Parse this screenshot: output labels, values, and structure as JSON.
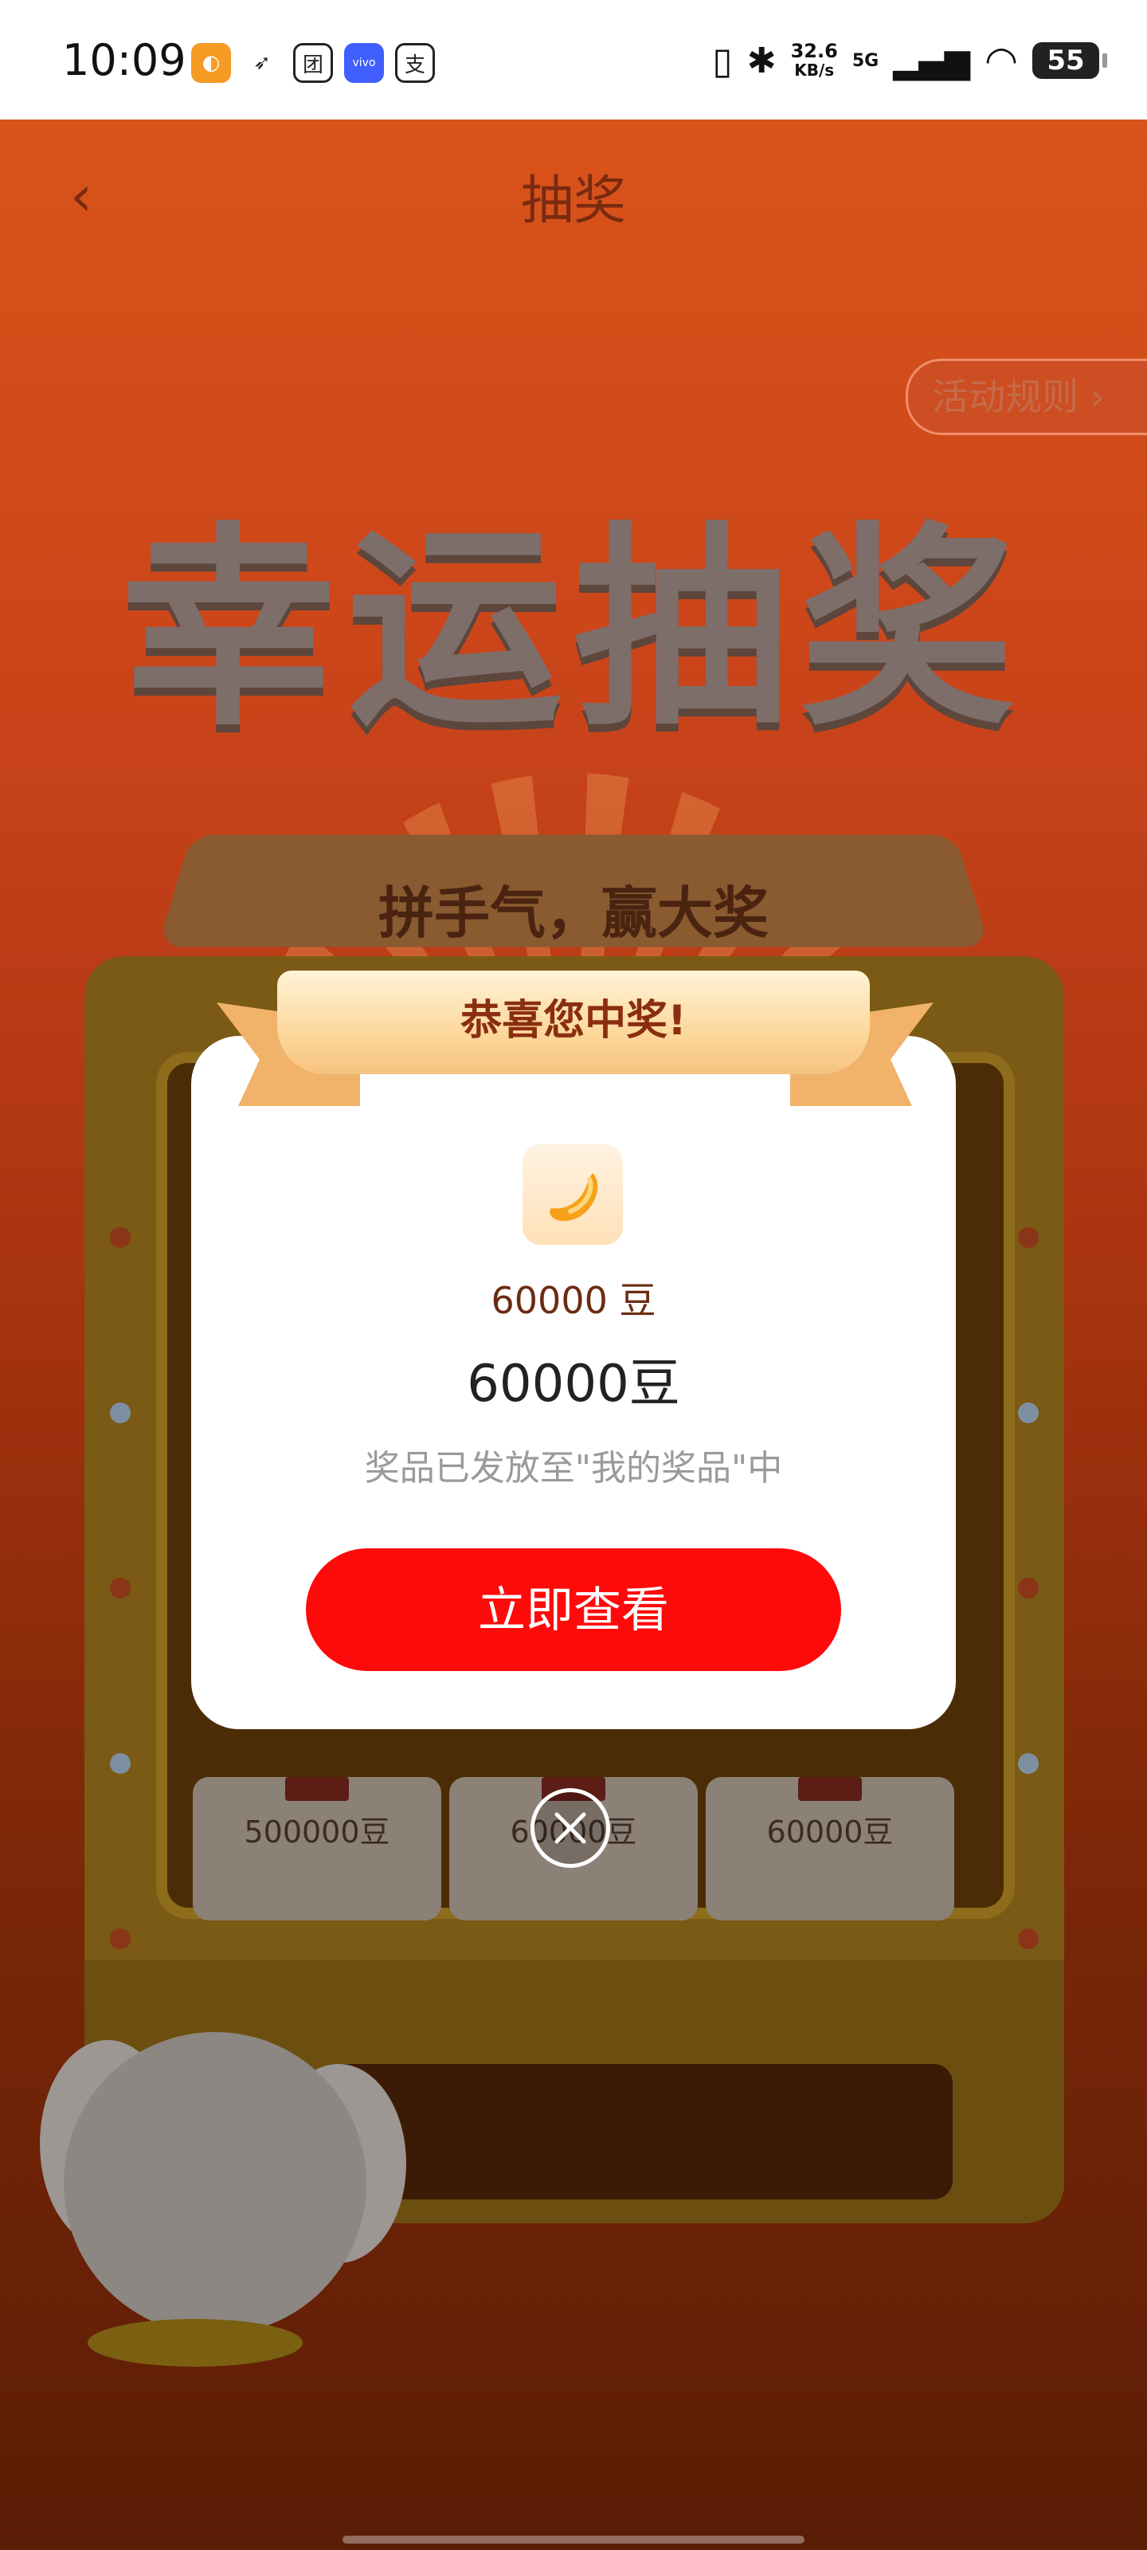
{
  "status_bar": {
    "time": "10:09",
    "apps": [
      {
        "icon": "orange-app-icon",
        "color": "#f59a23",
        "glyph": "◐"
      },
      {
        "icon": "bird-app-icon",
        "color": "#ffffff",
        "glyph": "➶"
      },
      {
        "icon": "tuan-app-icon",
        "color": "#ffffff",
        "glyph": "团"
      },
      {
        "icon": "vivo-app-icon",
        "color": "#415fff",
        "glyph": "vivo"
      },
      {
        "icon": "pay-app-icon",
        "color": "#ffffff",
        "glyph": "支"
      }
    ],
    "speed_value": "32.6",
    "speed_unit": "KB/s",
    "network": "5G",
    "battery": "55"
  },
  "header": {
    "title": "抽奖",
    "rules_button": "活动规则 ›"
  },
  "background": {
    "headline": "幸运抽奖",
    "slogan": "拼手气，赢大奖",
    "prize_cells": [
      "500000豆",
      "60000豆",
      "60000豆"
    ]
  },
  "dialog": {
    "banner": "恭喜您中奖!",
    "prize_name": "60000 豆",
    "prize_amount": "60000豆",
    "note": "奖品已发放至\"我的奖品\"中",
    "view_button": "立即查看"
  },
  "colors": {
    "primary_button": "#ff0a0a",
    "banner_text": "#8b2e10"
  }
}
